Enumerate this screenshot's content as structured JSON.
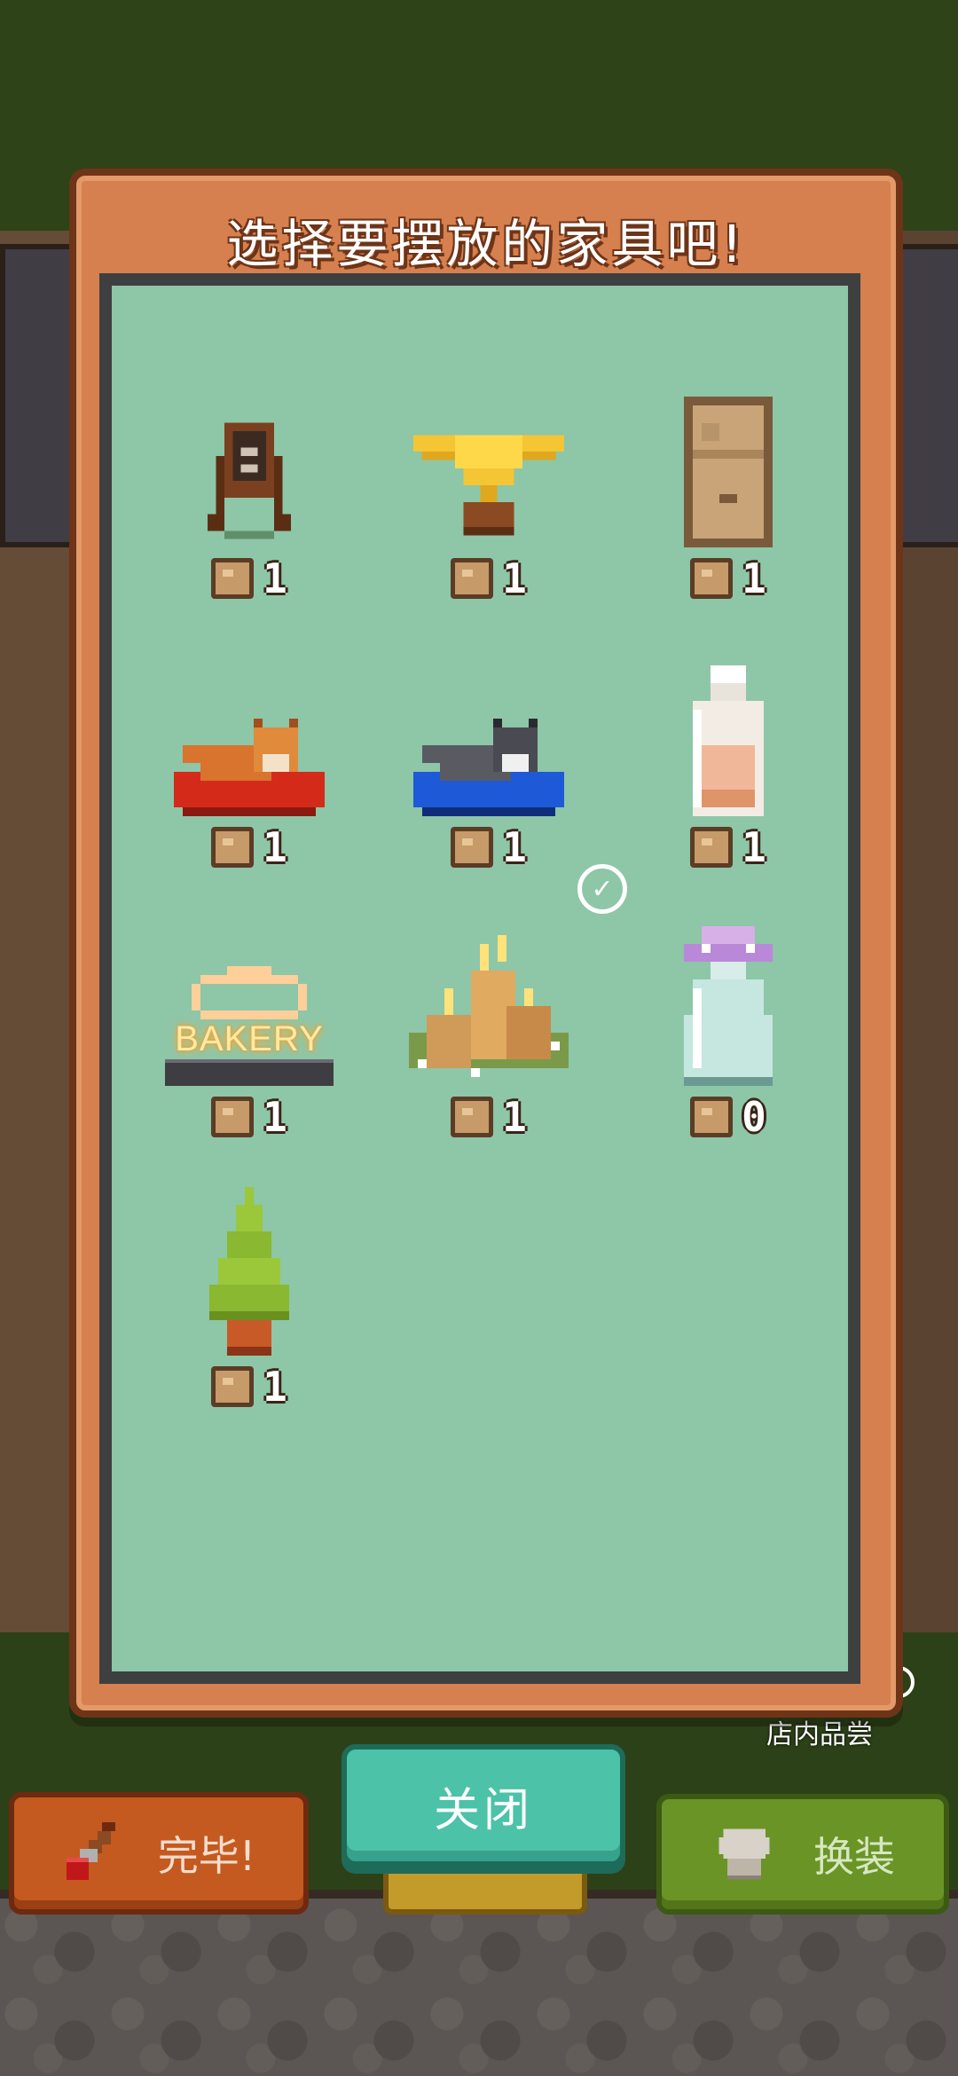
{
  "dialog": {
    "title": "选择要摆放的家具吧!"
  },
  "items": [
    {
      "icon": "sandwich-board-icon",
      "count": "1"
    },
    {
      "icon": "golden-heart-trophy-icon",
      "count": "1"
    },
    {
      "icon": "cardboard-box-icon",
      "count": "1"
    },
    {
      "icon": "shiba-cushion-icon",
      "count": "1"
    },
    {
      "icon": "husky-cushion-icon",
      "count": "1"
    },
    {
      "icon": "milk-bottle-icon",
      "count": "1"
    },
    {
      "icon": "bakery-neon-sign-icon",
      "count": "1",
      "sign_text": "BAKERY"
    },
    {
      "icon": "stump-candles-icon",
      "count": "1"
    },
    {
      "icon": "ufo-glass-jar-icon",
      "count": "0",
      "selected": true
    },
    {
      "icon": "pine-tree-icon",
      "count": "1"
    }
  ],
  "buttons": {
    "close_label": "关闭",
    "finish_label": "完毕!",
    "swap_label": "换装"
  },
  "hud": {
    "shop_label": "店内品尝"
  },
  "colors": {
    "dialog_frame": "#d5804e",
    "dialog_inner": "#8ec6a8",
    "close_button": "#4cc2a8",
    "finish_button": "#c45a1f",
    "swap_button": "#6a9426"
  }
}
